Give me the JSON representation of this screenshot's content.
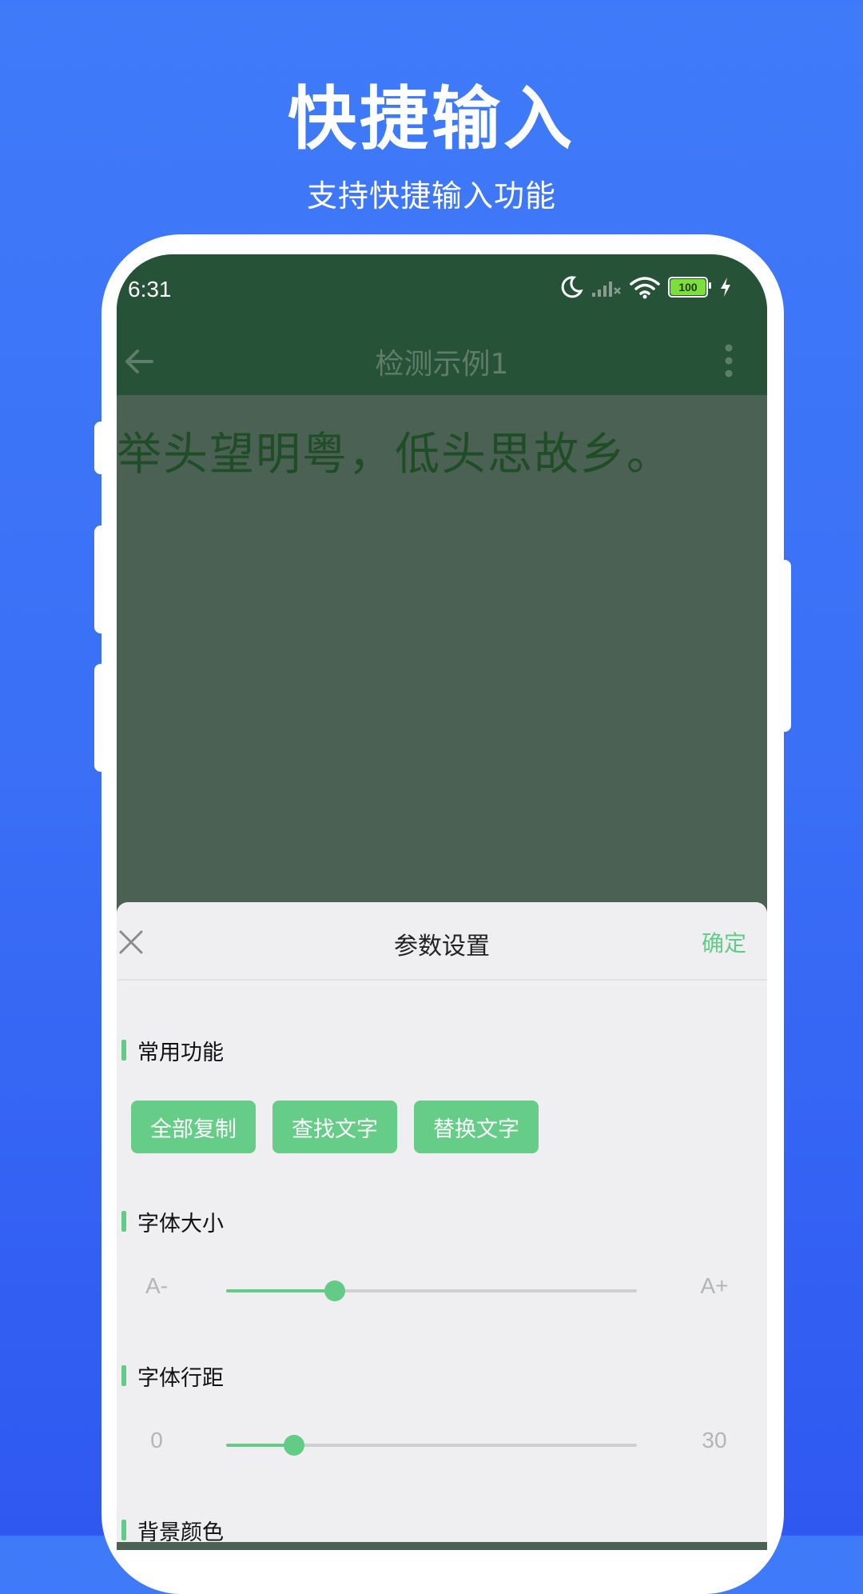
{
  "promo": {
    "title": "快捷输入",
    "subtitle": "支持快捷输入功能"
  },
  "status_bar": {
    "time": "6:31",
    "battery_level": "100"
  },
  "toolbar": {
    "title": "检测示例1"
  },
  "document": {
    "text": "举头望明粤，低头思故乡。"
  },
  "sheet": {
    "title": "参数设置",
    "confirm_label": "确定",
    "sections": {
      "common": {
        "label": "常用功能",
        "buttons": [
          "全部复制",
          "查找文字",
          "替换文字"
        ]
      },
      "font_size": {
        "label": "字体大小",
        "min_label": "A-",
        "max_label": "A+",
        "value_fraction": 0.265
      },
      "line_spacing": {
        "label": "字体行距",
        "min_label": "0",
        "max_label": "30",
        "value_fraction": 0.165
      },
      "background": {
        "label": "背景颜色"
      }
    }
  },
  "colors": {
    "accent": "#62cc86",
    "toolbar": "#265337",
    "background": "#3a6ff6"
  }
}
